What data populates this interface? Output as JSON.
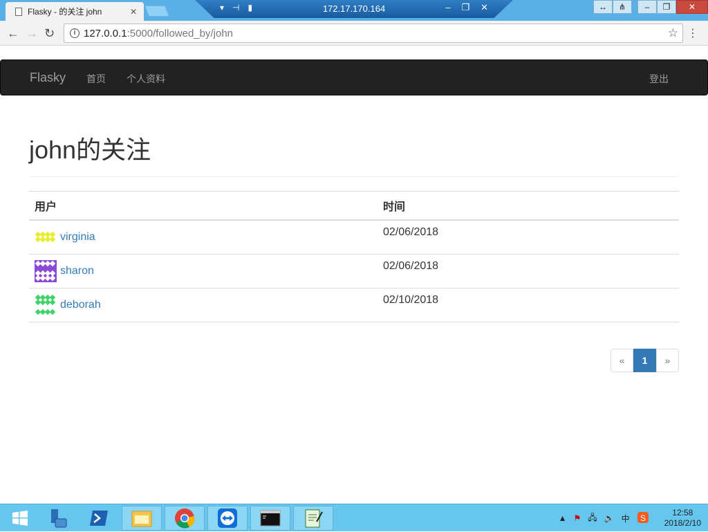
{
  "browser": {
    "tab_title": "Flasky - 的关注 john",
    "url_host": "127.0.0.1",
    "url_path": ":5000/followed_by/john"
  },
  "remote": {
    "ip": "172.17.170.164"
  },
  "navbar": {
    "brand": "Flasky",
    "links": [
      "首页",
      "个人资料"
    ],
    "logout": "登出"
  },
  "page": {
    "title": "john的关注",
    "columns": [
      "用户",
      "时间"
    ],
    "rows": [
      {
        "user": "virginia",
        "time": "02/06/2018",
        "avatar_color": "#e6ee2a"
      },
      {
        "user": "sharon",
        "time": "02/06/2018",
        "avatar_color": "#8c4bd6"
      },
      {
        "user": "deborah",
        "time": "02/10/2018",
        "avatar_color": "#3fd36a"
      }
    ],
    "pagination": {
      "prev": "«",
      "current": "1",
      "next": "»"
    }
  },
  "taskbar": {
    "ime": "中",
    "time": "12:58",
    "date": "2018/2/10"
  }
}
